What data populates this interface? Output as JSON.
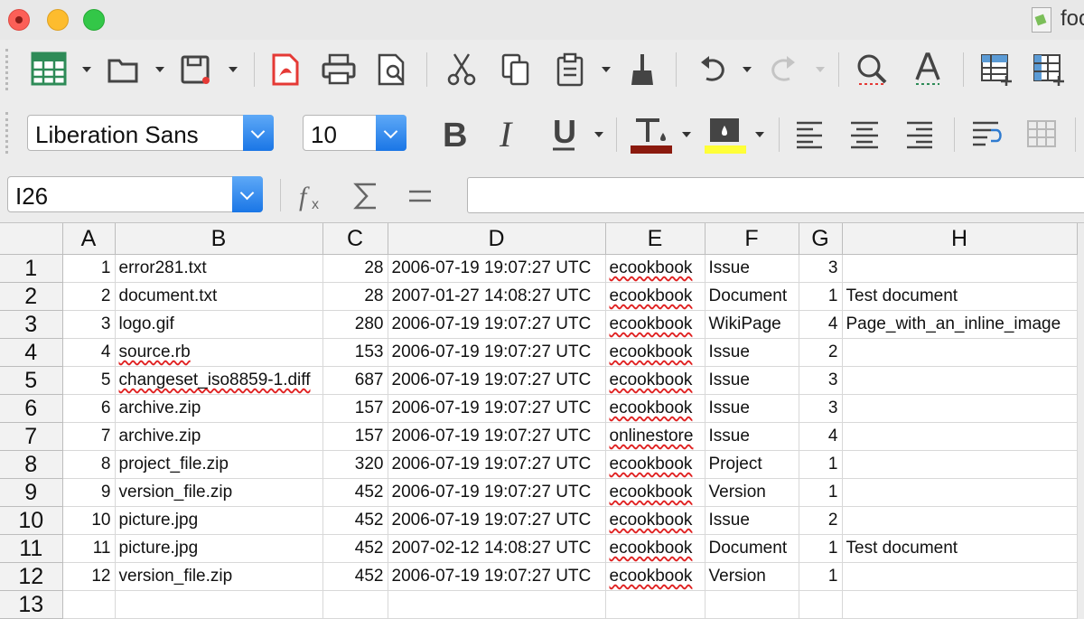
{
  "window": {
    "title": "foo"
  },
  "toolbar2": {
    "font_name": "Liberation Sans",
    "font_size": "10",
    "font_color": "#8b1a0e",
    "highlight_color": "#ffff38"
  },
  "formula_bar": {
    "cell_ref": "I26",
    "content": ""
  },
  "columns": [
    "A",
    "B",
    "C",
    "D",
    "E",
    "F",
    "G",
    "H"
  ],
  "rows": [
    {
      "n": "1",
      "a": "1",
      "b": "error281.txt",
      "c": "28",
      "d": "2006-07-19 19:07:27 UTC",
      "e": "ecookbook",
      "f": "Issue",
      "g": "3",
      "h": ""
    },
    {
      "n": "2",
      "a": "2",
      "b": "document.txt",
      "c": "28",
      "d": "2007-01-27 14:08:27 UTC",
      "e": "ecookbook",
      "f": "Document",
      "g": "1",
      "h": "Test document"
    },
    {
      "n": "3",
      "a": "3",
      "b": "logo.gif",
      "c": "280",
      "d": "2006-07-19 19:07:27 UTC",
      "e": "ecookbook",
      "f": "WikiPage",
      "g": "4",
      "h": "Page_with_an_inline_image"
    },
    {
      "n": "4",
      "a": "4",
      "b": "source.rb",
      "c": "153",
      "d": "2006-07-19 19:07:27 UTC",
      "e": "ecookbook",
      "f": "Issue",
      "g": "2",
      "h": ""
    },
    {
      "n": "5",
      "a": "5",
      "b": "changeset_iso8859-1.diff",
      "c": "687",
      "d": "2006-07-19 19:07:27 UTC",
      "e": "ecookbook",
      "f": "Issue",
      "g": "3",
      "h": ""
    },
    {
      "n": "6",
      "a": "6",
      "b": "archive.zip",
      "c": "157",
      "d": "2006-07-19 19:07:27 UTC",
      "e": "ecookbook",
      "f": "Issue",
      "g": "3",
      "h": ""
    },
    {
      "n": "7",
      "a": "7",
      "b": "archive.zip",
      "c": "157",
      "d": "2006-07-19 19:07:27 UTC",
      "e": "onlinestore",
      "f": "Issue",
      "g": "4",
      "h": ""
    },
    {
      "n": "8",
      "a": "8",
      "b": "project_file.zip",
      "c": "320",
      "d": "2006-07-19 19:07:27 UTC",
      "e": "ecookbook",
      "f": "Project",
      "g": "1",
      "h": ""
    },
    {
      "n": "9",
      "a": "9",
      "b": "version_file.zip",
      "c": "452",
      "d": "2006-07-19 19:07:27 UTC",
      "e": "ecookbook",
      "f": "Version",
      "g": "1",
      "h": ""
    },
    {
      "n": "10",
      "a": "10",
      "b": "picture.jpg",
      "c": "452",
      "d": "2006-07-19 19:07:27 UTC",
      "e": "ecookbook",
      "f": "Issue",
      "g": "2",
      "h": ""
    },
    {
      "n": "11",
      "a": "11",
      "b": "picture.jpg",
      "c": "452",
      "d": "2007-02-12 14:08:27 UTC",
      "e": "ecookbook",
      "f": "Document",
      "g": "1",
      "h": "Test document"
    },
    {
      "n": "12",
      "a": "12",
      "b": "version_file.zip",
      "c": "452",
      "d": "2006-07-19 19:07:27 UTC",
      "e": "ecookbook",
      "f": "Version",
      "g": "1",
      "h": ""
    },
    {
      "n": "13",
      "a": "",
      "b": "",
      "c": "",
      "d": "",
      "e": "",
      "f": "",
      "g": "",
      "h": ""
    }
  ]
}
